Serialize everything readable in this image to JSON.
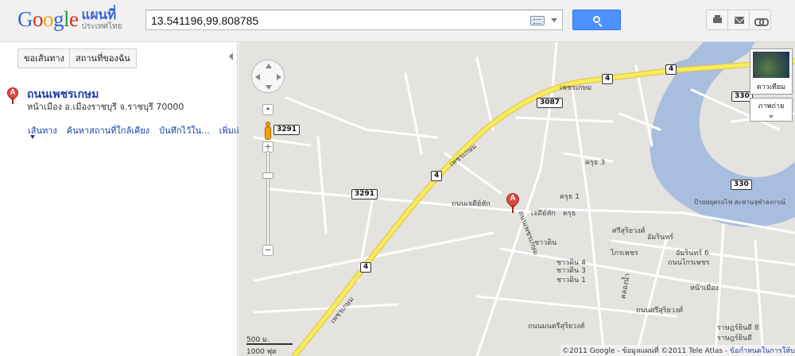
{
  "header": {
    "logo_word": "Google",
    "logo_title": "แผนที่",
    "logo_subtitle": "ประเทศไทย",
    "search_value": "13.541196,99.808785",
    "icons": [
      "keyboard-icon",
      "search-icon",
      "print-icon",
      "mail-icon",
      "link-icon"
    ]
  },
  "left_panel": {
    "directions_button": "ขอเส้นทาง",
    "my_places_button": "สถานที่ของฉัน",
    "result": {
      "marker": "A",
      "title": "ถนนเพชรเกษม",
      "address": "หน้าเมือง อ.เมืองราชบุรี จ.ราชบุรี 70000",
      "links": [
        "เส้นทาง",
        "ค้นหาสถานที่ใกล้เคียง",
        "บันทึกไว้ใน...",
        "เพิ่มเติม"
      ]
    }
  },
  "map": {
    "marker": "A",
    "satellite_label": "ดาวเทียม",
    "terrain_label": "ภาพถ่าย",
    "scale_metric": "500 ม.",
    "scale_imperial": "1000 ฟุต",
    "copyright": "©2011 Google - ข้อมูลแผนที่ ©2011 Tele Atlas -",
    "terms_link": "ข้อกำหนดในการให้บริการ",
    "shields": [
      "4",
      "4",
      "3087",
      "330",
      "3291",
      "4",
      "3291",
      "330",
      "4"
    ],
    "labels": [
      "เพชรเกษม",
      "เพชรเกษม",
      "เพชรเกษม",
      "ถนนเจดีย์หัก",
      "ถนนเพชรเกษม",
      "เจดีย์หัก",
      "ชาวดิน",
      "ชาวดิน 4",
      "ชาวดิน 3",
      "ชาวดิน 1",
      "ครุธ 3",
      "ครุธ 1",
      "ครุธ",
      "ป้ายหยุดรถไฟ สะพานจุฬาลงกรณ์",
      "อัมรินทร์",
      "อัมรินทร์ 6",
      "ถนนไกรเพชร",
      "ไกรเพชร",
      "ศรีสุริยวงศ์",
      "ถนนศรีสุริยวงศ์",
      "ราษฎร์ยินดี 8",
      "ราษฎร์ยินดี",
      "คลองน้ำ",
      "ถนนมนตรีสุริยวงศ์",
      "หน้าเมือง"
    ],
    "colors": {
      "land": "#e5e3df",
      "road": "#ffffff",
      "highway": "#f7ec5e",
      "water": "#a9bedf"
    }
  }
}
